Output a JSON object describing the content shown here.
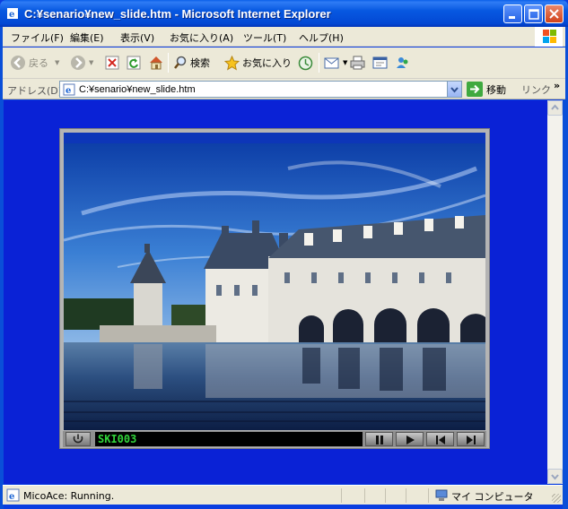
{
  "window": {
    "title": "C:¥senario¥new_slide.htm - Microsoft Internet Explorer"
  },
  "menu": [
    {
      "label": "ファイル(F)"
    },
    {
      "label": "編集(E)"
    },
    {
      "label": "表示(V)"
    },
    {
      "label": "お気に入り(A)"
    },
    {
      "label": "ツール(T)"
    },
    {
      "label": "ヘルプ(H)"
    }
  ],
  "toolbar": {
    "back_label": "戻る",
    "search_label": "検索",
    "favorites_label": "お気に入り"
  },
  "address": {
    "label": "アドレス(D)",
    "value": "C:¥senario¥new_slide.htm",
    "go_label": "移動",
    "links_label": "リンク",
    "links_more": "»"
  },
  "player": {
    "slide_name": "SKI003",
    "image_subject": "chateau-de-chenonceau-photo"
  },
  "status": {
    "text": "MicoAce: Running.",
    "zone": "マイ コンピュータ"
  },
  "colors": {
    "page_background": "#0a22d6",
    "slide_name_text": "#31d53b",
    "titlebar": "#0758e1"
  }
}
